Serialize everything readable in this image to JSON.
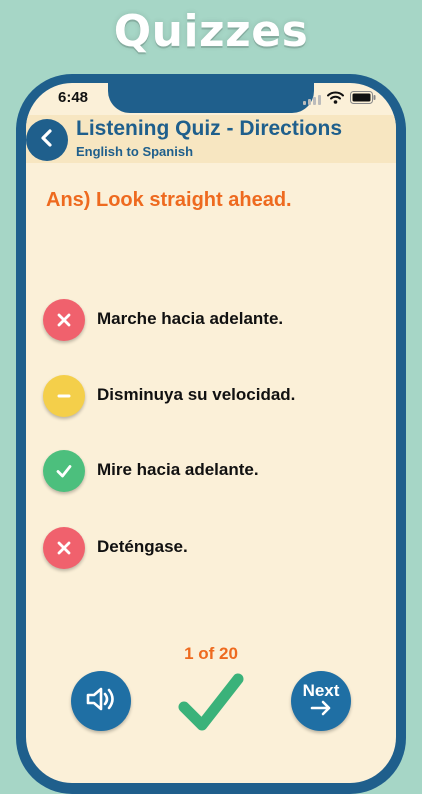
{
  "banner": {
    "title": "Quizzes"
  },
  "status_bar": {
    "time": "6:48"
  },
  "header": {
    "title": "Listening Quiz - Directions",
    "subtitle": "English to Spanish"
  },
  "question": {
    "answer_text": "Ans) Look straight ahead."
  },
  "options": [
    {
      "label": "Marche hacia adelante.",
      "state": "wrong",
      "icon": "x-icon",
      "color": "#f0616d"
    },
    {
      "label": "Disminuya su velocidad.",
      "state": "skipped",
      "icon": "minus-icon",
      "color": "#f4cf4a"
    },
    {
      "label": "Mire hacia adelante.",
      "state": "correct",
      "icon": "check-icon",
      "color": "#4cbf7d"
    },
    {
      "label": "Deténgase.",
      "state": "wrong",
      "icon": "x-icon",
      "color": "#f0616d"
    }
  ],
  "progress": {
    "text": "1 of 20",
    "current": 1,
    "total": 20
  },
  "controls": {
    "audio_icon": "speaker-icon",
    "check_icon": "check-icon",
    "next_label": "Next",
    "next_icon": "arrow-right-icon"
  },
  "colors": {
    "brand_blue": "#1f5f8c",
    "accent_orange": "#ee6a1f",
    "background": "#fbf0d8",
    "correct_green": "#3ab27a"
  }
}
